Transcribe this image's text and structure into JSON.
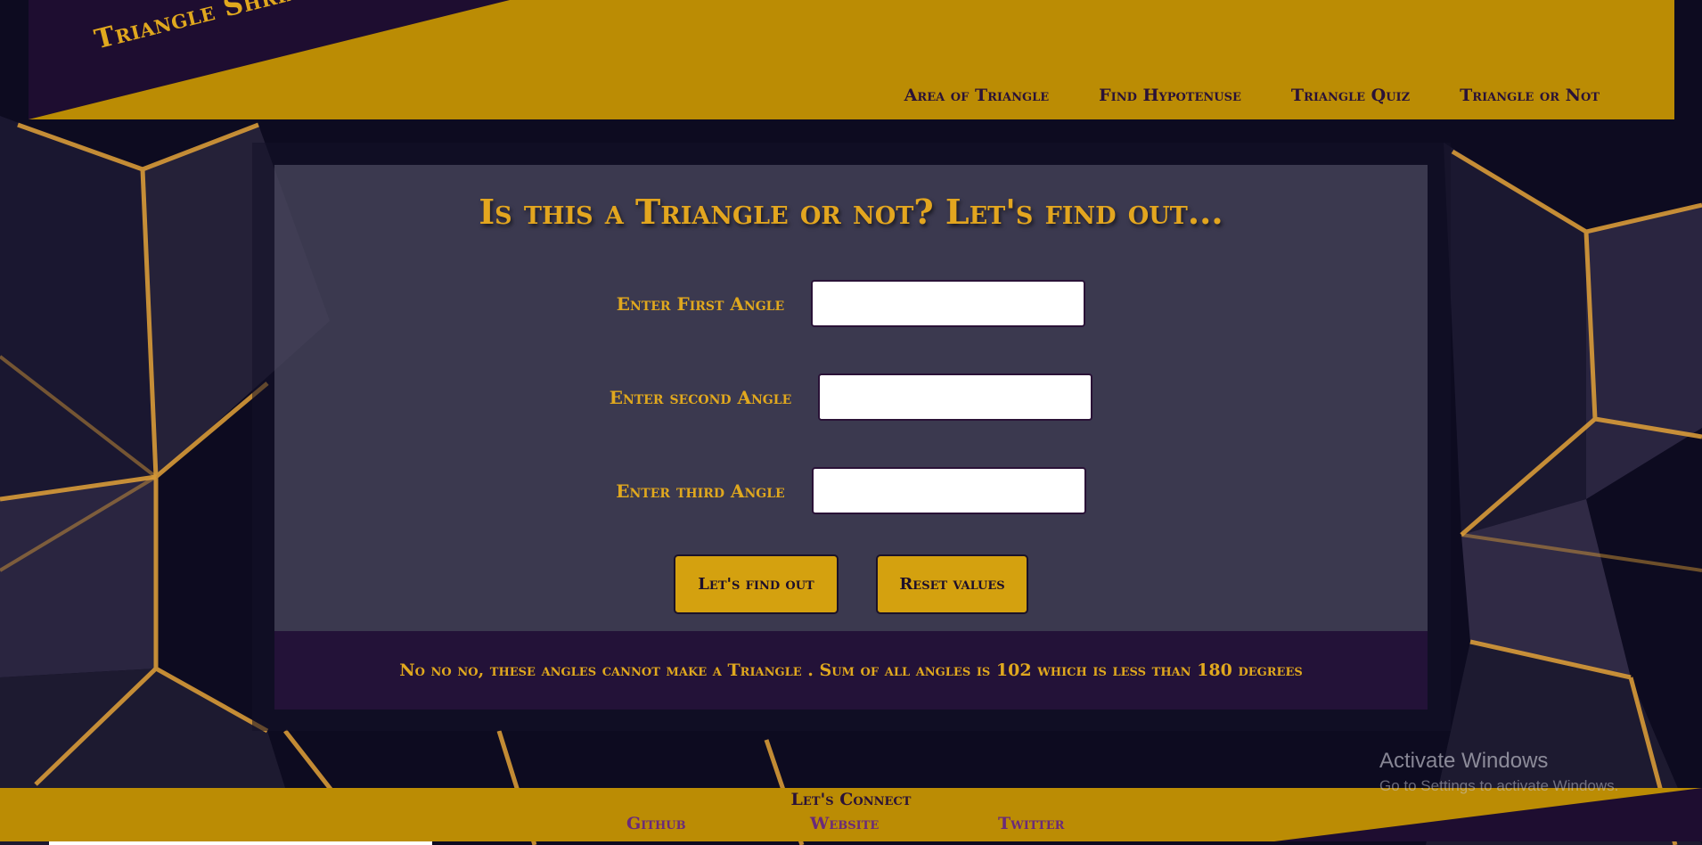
{
  "header": {
    "logo": "Triangle Shriangle",
    "nav": [
      {
        "label": "Area of Triangle"
      },
      {
        "label": "Find Hypotenuse"
      },
      {
        "label": "Triangle Quiz"
      },
      {
        "label": "Triangle or Not"
      }
    ]
  },
  "main": {
    "title": "Is this a Triangle or not? Let's find out...",
    "fields": [
      {
        "label": "Enter First Angle",
        "value": ""
      },
      {
        "label": "Enter second Angle",
        "value": ""
      },
      {
        "label": "Enter third Angle",
        "value": ""
      }
    ],
    "buttons": {
      "find": "Let's find out",
      "reset": "Reset values"
    },
    "output": "No no no, these angles cannot make a Triangle . Sum of all angles is 102 which is less than 180 degrees"
  },
  "footer": {
    "title": "Let's Connect",
    "links": {
      "github": "Github",
      "website": "Website",
      "twitter": "Twitter"
    }
  },
  "watermark": {
    "title": "Activate Windows",
    "subtitle": "Go to Settings to activate Windows."
  },
  "colors": {
    "gold": "#bb8c04",
    "accent_gold": "#e0a81e",
    "purple_dark": "#231238",
    "navy_bg": "#0c0a1e"
  }
}
